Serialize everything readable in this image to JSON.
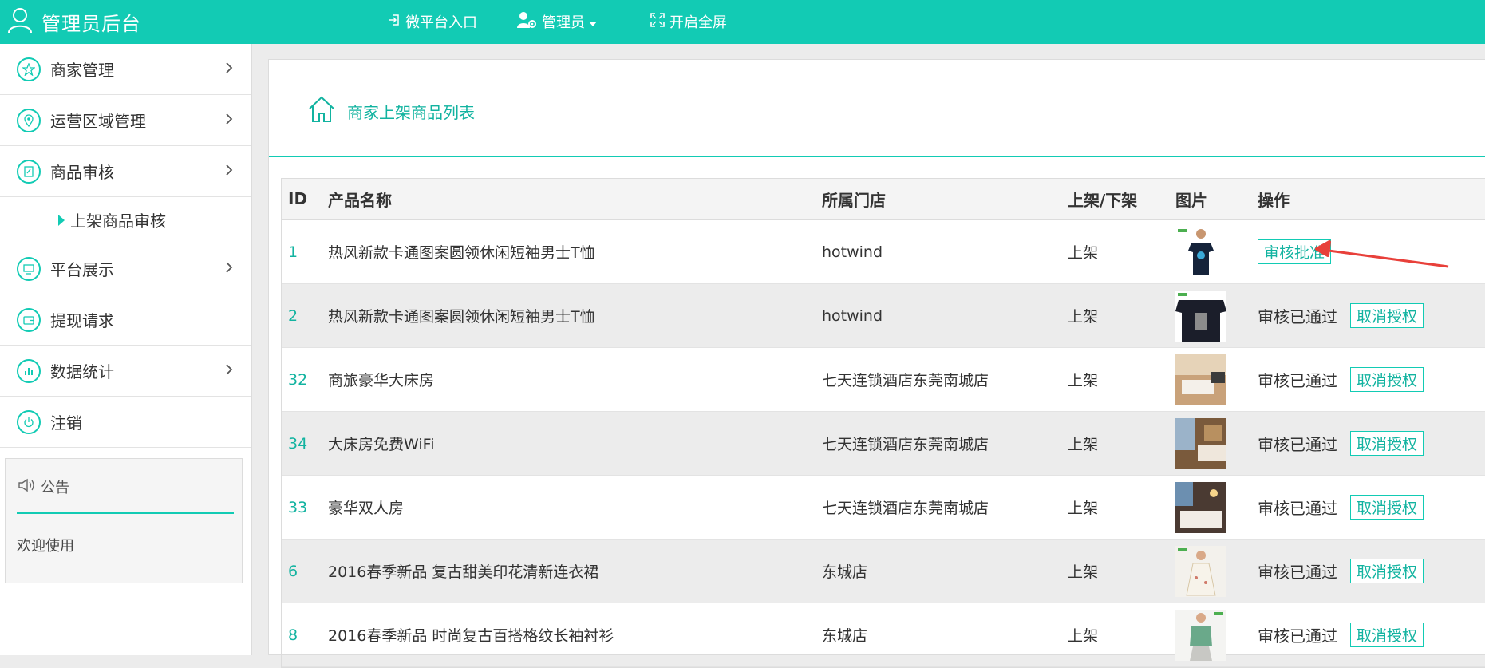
{
  "header": {
    "title": "管理员后台",
    "nav": {
      "wechat": "微平台入口",
      "admin": "管理员",
      "fullscreen": "开启全屏"
    }
  },
  "sidebar": {
    "items": [
      {
        "label": "商家管理"
      },
      {
        "label": "运营区域管理"
      },
      {
        "label": "商品审核"
      },
      {
        "label": "平台展示"
      },
      {
        "label": "提现请求"
      },
      {
        "label": "数据统计"
      },
      {
        "label": "注销"
      }
    ],
    "sub_item": "上架商品审核",
    "notice": {
      "title": "公告",
      "body": "欢迎使用"
    }
  },
  "main": {
    "breadcrumb": "商家上架商品列表",
    "table": {
      "columns": [
        "ID",
        "产品名称",
        "所属门店",
        "上架/下架",
        "图片",
        "操作"
      ],
      "rows": [
        {
          "id": "1",
          "name": "热风新款卡通图案圆领休闲短袖男士T恤",
          "store": "hotwind",
          "shelf": "上架",
          "status": "",
          "action": "审核批准"
        },
        {
          "id": "2",
          "name": "热风新款卡通图案圆领休闲短袖男士T恤",
          "store": "hotwind",
          "shelf": "上架",
          "status": "审核已通过",
          "action": "取消授权"
        },
        {
          "id": "32",
          "name": "商旅豪华大床房",
          "store": "七天连锁酒店东莞南城店",
          "shelf": "上架",
          "status": "审核已通过",
          "action": "取消授权"
        },
        {
          "id": "34",
          "name": "大床房免费WiFi",
          "store": "七天连锁酒店东莞南城店",
          "shelf": "上架",
          "status": "审核已通过",
          "action": "取消授权"
        },
        {
          "id": "33",
          "name": "豪华双人房",
          "store": "七天连锁酒店东莞南城店",
          "shelf": "上架",
          "status": "审核已通过",
          "action": "取消授权"
        },
        {
          "id": "6",
          "name": "2016春季新品 复古甜美印花清新连衣裙",
          "store": "东城店",
          "shelf": "上架",
          "status": "审核已通过",
          "action": "取消授权"
        },
        {
          "id": "8",
          "name": "2016春季新品 时尚复古百搭格纹长袖衬衫",
          "store": "东城店",
          "shelf": "上架",
          "status": "审核已通过",
          "action": "取消授权"
        }
      ]
    }
  },
  "colors": {
    "accent": "#12cbb4",
    "annotation_arrow": "#e8403a"
  }
}
